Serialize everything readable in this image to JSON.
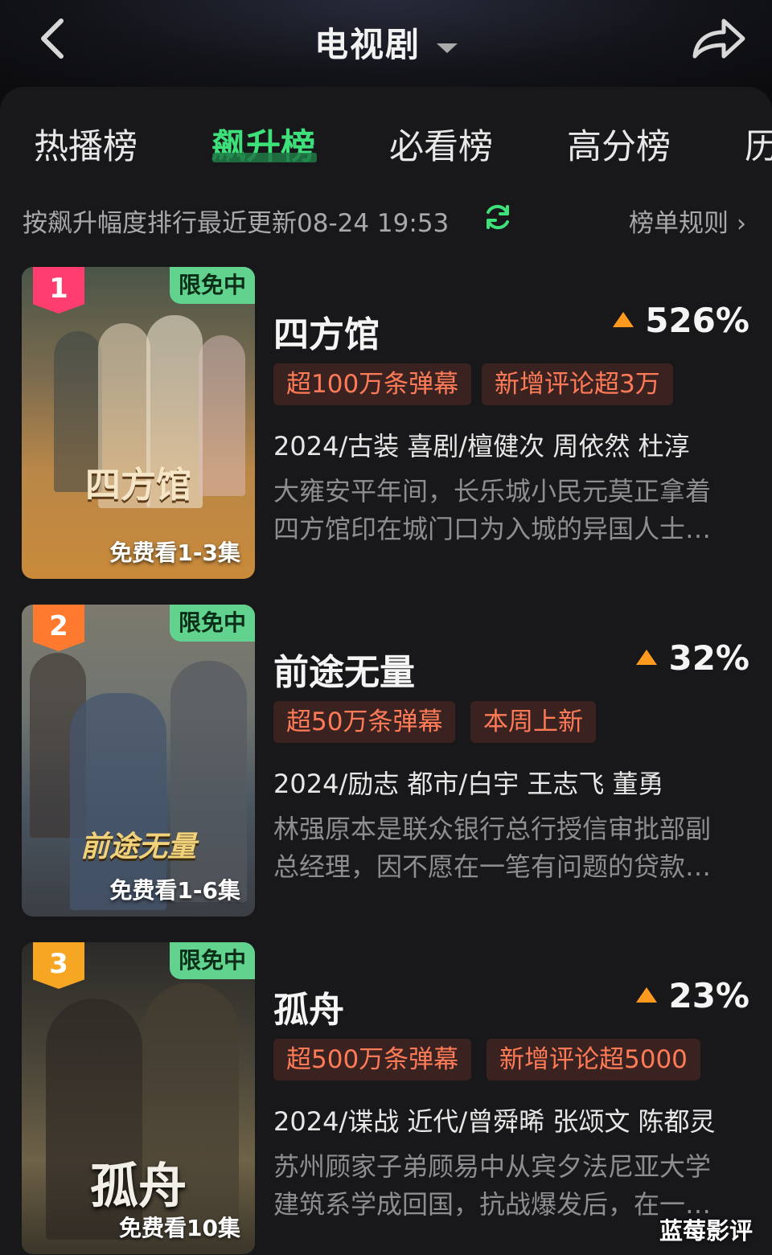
{
  "header": {
    "title": "电视剧",
    "back_icon": "chevron-left-icon",
    "share_icon": "share-icon",
    "dropdown_icon": "caret-down-icon"
  },
  "tabs": [
    {
      "label": "热播榜",
      "active": false
    },
    {
      "label": "飙升榜",
      "active": true
    },
    {
      "label": "必看榜",
      "active": false
    },
    {
      "label": "高分榜",
      "active": false
    },
    {
      "label": "历",
      "active": false
    }
  ],
  "subbar": {
    "text": "按飙升幅度排行最近更新08-24 19:53",
    "refresh_icon": "refresh-icon",
    "rules_label": "榜单规则",
    "rules_chevron": "›"
  },
  "colors": {
    "accent_green": "#3ee07a",
    "tag_text": "#ff7b57",
    "tag_bg": "#3a2220",
    "trend_up": "#ff9a1f"
  },
  "items": [
    {
      "rank": "1",
      "free_badge": "限免中",
      "poster_title": "四方馆",
      "free_episodes": "免费看1-3集",
      "title": "四方馆",
      "trend": "526%",
      "tags": [
        "超100万条弹幕",
        "新增评论超3万"
      ],
      "meta": "2024/古装 喜剧/檀健次 周依然 杜淳",
      "desc_line1": "大雍安平年间，长乐城小民元莫正拿着",
      "desc_line2": "四方馆印在城门口为入城的异国人士…"
    },
    {
      "rank": "2",
      "free_badge": "限免中",
      "poster_title": "前途无量",
      "free_episodes": "免费看1-6集",
      "title": "前途无量",
      "trend": "32%",
      "tags": [
        "超50万条弹幕",
        "本周上新"
      ],
      "meta": "2024/励志 都市/白宇 王志飞 董勇",
      "desc_line1": "林强原本是联众银行总行授信审批部副",
      "desc_line2": "总经理，因不愿在一笔有问题的贷款…"
    },
    {
      "rank": "3",
      "free_badge": "限免中",
      "poster_title": "孤舟",
      "free_episodes": "免费看10集",
      "title": "孤舟",
      "trend": "23%",
      "tags": [
        "超500万条弹幕",
        "新增评论超5000"
      ],
      "meta": "2024/谍战 近代/曾舜晞 张颂文 陈都灵",
      "desc_line1": "苏州顾家子弟顾易中从宾夕法尼亚大学",
      "desc_line2": "建筑系学成回国，抗战爆发后，在一…"
    }
  ],
  "watermark": "蓝莓影评"
}
